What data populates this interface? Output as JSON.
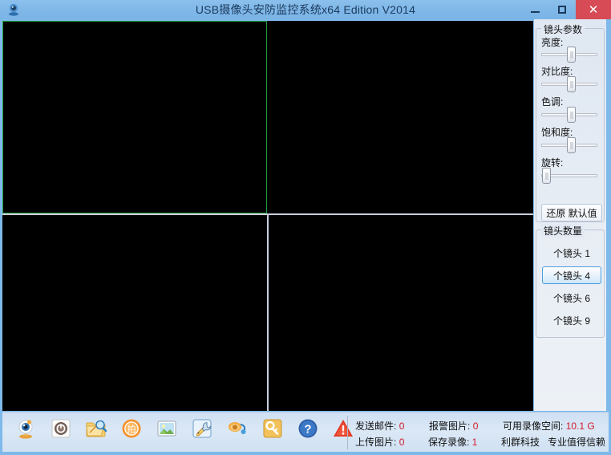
{
  "window": {
    "title": "USB摄像头安防监控系统x64 Edition V2014",
    "app_icon": "webcam-icon",
    "minimize_label": "—",
    "maximize_label": "▢",
    "close_label": "✕",
    "close_color": "#d64b55",
    "titlebar_color": "#7fb7e8"
  },
  "video": {
    "active_cell_border_color": "#1f9e3f",
    "divider_color": "#c9cfdd",
    "background_color": "#000000",
    "cells": [
      {
        "id": "cell-1",
        "active": true
      },
      {
        "id": "cell-2",
        "active": false
      },
      {
        "id": "cell-3",
        "active": false
      },
      {
        "id": "cell-4",
        "active": false
      }
    ]
  },
  "params_panel": {
    "title": "镜头参数",
    "sliders": [
      {
        "label": "亮度:",
        "thumb_pct": 50
      },
      {
        "label": "对比度:",
        "thumb_pct": 50
      },
      {
        "label": "色调:",
        "thumb_pct": 50
      },
      {
        "label": "饱和度:",
        "thumb_pct": 50
      },
      {
        "label": "旋转:",
        "thumb_pct": 0
      }
    ],
    "reset_button": "还原 默认值"
  },
  "count_panel": {
    "title": "镜头数量",
    "selected_index": 1,
    "options": [
      {
        "label": "个镜头 1",
        "value": "1"
      },
      {
        "label": "个镜头 4",
        "value": "4"
      },
      {
        "label": "个镜头 6",
        "value": "6"
      },
      {
        "label": "个镜头 9",
        "value": "9"
      }
    ],
    "selection_color": "#4a9ddb"
  },
  "toolbar": {
    "icons": [
      {
        "name": "webcam-icon",
        "glyph": ""
      },
      {
        "name": "power-icon",
        "glyph": ""
      },
      {
        "name": "folder-search-icon",
        "glyph": ""
      },
      {
        "name": "capture-icon",
        "glyph": "拍"
      },
      {
        "name": "picture-icon",
        "glyph": ""
      },
      {
        "name": "settings-icon",
        "glyph": ""
      },
      {
        "name": "audio-icon",
        "glyph": ""
      },
      {
        "name": "key-icon",
        "glyph": ""
      },
      {
        "name": "help-icon",
        "glyph": "?"
      },
      {
        "name": "alert-icon",
        "glyph": "!"
      }
    ]
  },
  "status": {
    "send_mail_label": "发送邮件:",
    "send_mail_value": "0",
    "alarm_picture_label": "报警图片:",
    "alarm_picture_value": "0",
    "free_space_label": "可用录像空间:",
    "free_space_value": "10.1 G",
    "upload_picture_label": "上传图片:",
    "upload_picture_value": "0",
    "save_record_label": "保存录像:",
    "save_record_value": "1",
    "company": "利群科技",
    "slogan": "专业值得信赖",
    "value_color": "#d11a2a"
  }
}
